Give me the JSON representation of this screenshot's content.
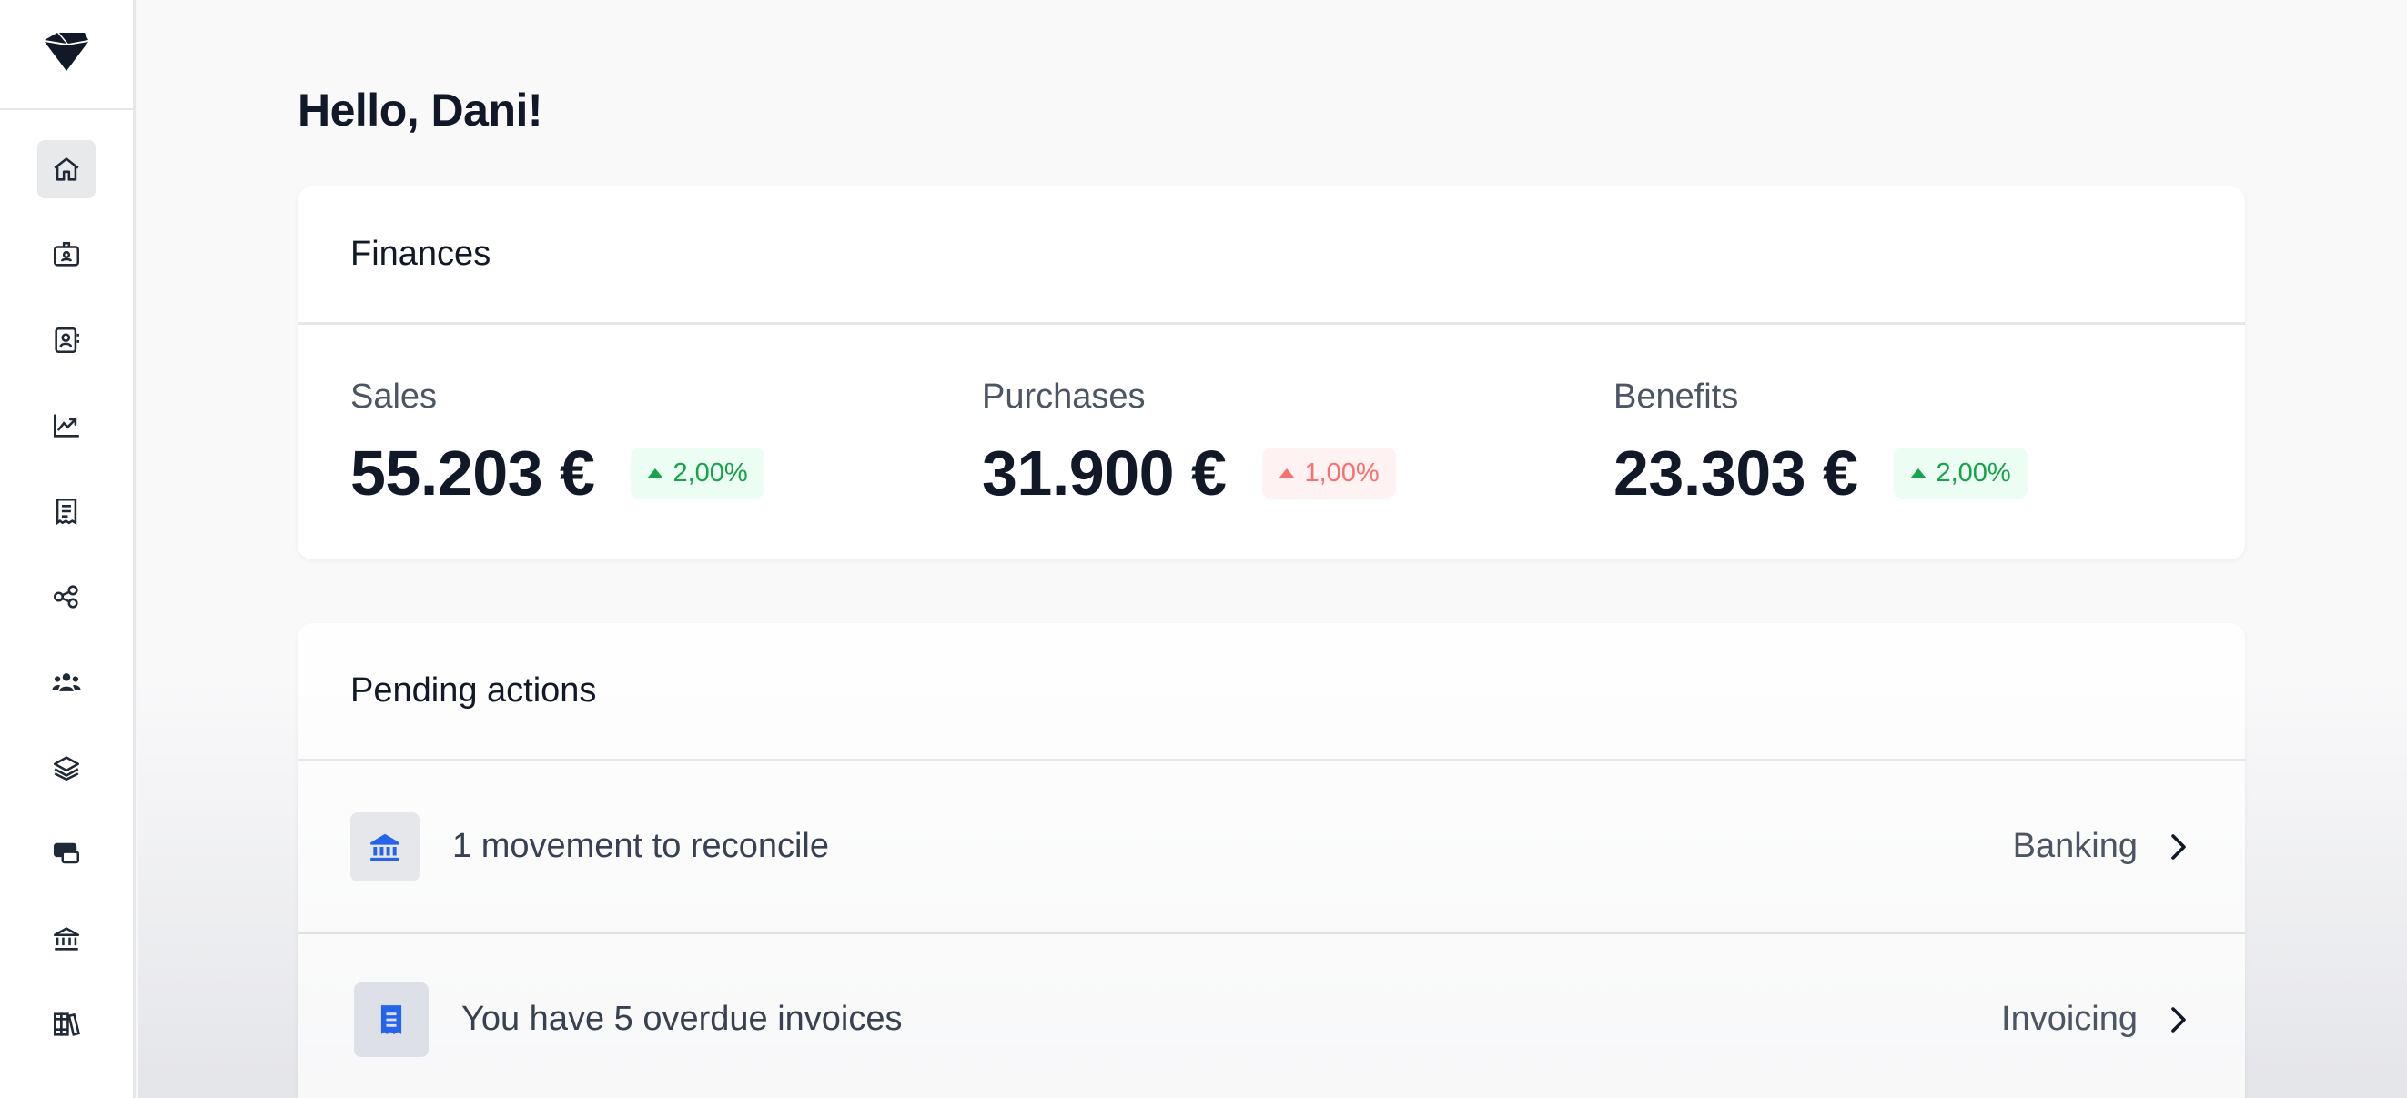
{
  "greeting": "Hello, Dani!",
  "sidebar": {
    "logo": "diamond-logo-icon",
    "items": [
      {
        "name": "home",
        "icon": "home-icon",
        "active": true
      },
      {
        "name": "id-card",
        "icon": "id-card-icon"
      },
      {
        "name": "contacts",
        "icon": "contact-book-icon"
      },
      {
        "name": "analytics",
        "icon": "chart-line-icon"
      },
      {
        "name": "receipts",
        "icon": "receipt-icon"
      },
      {
        "name": "share",
        "icon": "share-nodes-icon"
      },
      {
        "name": "team",
        "icon": "users-icon"
      },
      {
        "name": "layers",
        "icon": "layers-icon"
      },
      {
        "name": "payments",
        "icon": "cards-icon"
      },
      {
        "name": "bank",
        "icon": "bank-icon"
      },
      {
        "name": "library",
        "icon": "books-icon"
      }
    ]
  },
  "finances": {
    "title": "Finances",
    "metrics": [
      {
        "label": "Sales",
        "value": "55.203 €",
        "change": "2,00%",
        "trend": "up"
      },
      {
        "label": "Purchases",
        "value": "31.900 €",
        "change": "1,00%",
        "trend": "down"
      },
      {
        "label": "Benefits",
        "value": "23.303 €",
        "change": "2,00%",
        "trend": "up"
      }
    ]
  },
  "pending": {
    "title": "Pending actions",
    "actions": [
      {
        "text": "1 movement to reconcile",
        "link": "Banking",
        "icon": "bank-icon"
      },
      {
        "text": "You have 5 overdue invoices",
        "link": "Invoicing",
        "icon": "receipt-icon"
      }
    ]
  },
  "colors": {
    "accent": "#2563eb",
    "positive": "#16a34a",
    "negative": "#f87171"
  }
}
